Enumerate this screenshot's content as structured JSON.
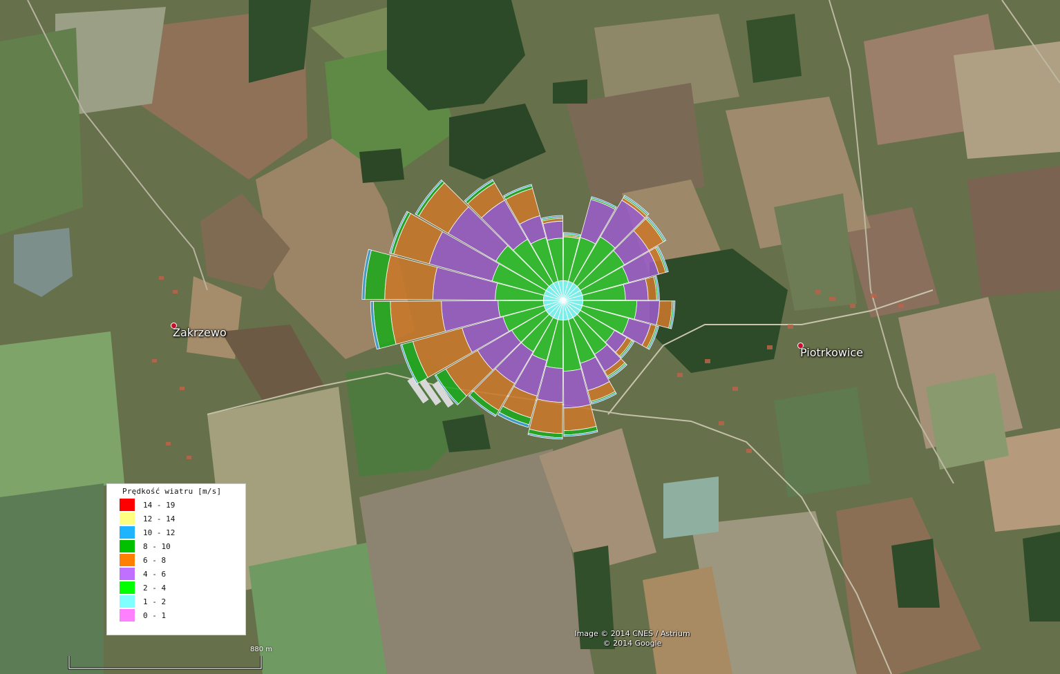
{
  "places": [
    {
      "name": "Zakrzewo"
    },
    {
      "name": "Piotrkowice"
    }
  ],
  "legend": {
    "title": "Prędkość wiatru [m/s]",
    "items": [
      {
        "label": "14 - 19",
        "color": "#ff0000"
      },
      {
        "label": "12 - 14",
        "color": "#ffff80"
      },
      {
        "label": "10 - 12",
        "color": "#1eb4ff"
      },
      {
        "label": "8 - 10",
        "color": "#00c000"
      },
      {
        "label": "6 - 8",
        "color": "#ff8000"
      },
      {
        "label": "4 - 6",
        "color": "#c070ff"
      },
      {
        "label": "2 - 4",
        "color": "#00ff00"
      },
      {
        "label": "1 - 2",
        "color": "#80ffff"
      },
      {
        "label": "0 - 1",
        "color": "#ff80ff"
      }
    ]
  },
  "attribution": {
    "line1": "Image © 2014 CNES / Astrium",
    "line2": "© 2014 Google"
  },
  "scale": {
    "label": "880 m"
  },
  "wind_rose": {
    "bins": [
      "0 - 1",
      "1 - 2",
      "2 - 4",
      "4 - 6",
      "6 - 8",
      "8 - 10",
      "10 - 12",
      "12 - 14",
      "14 - 19"
    ],
    "colors": {
      "1 - 2": "#80ffff",
      "2 - 4": "#2fc02f",
      "4 - 6": "#9a5cc8",
      "6 - 8": "#c9782a",
      "8 - 10": "#1fa81f",
      "10 - 12": "#3a9ed0",
      "12 - 14": "#f3e68a"
    },
    "sectors": [
      {
        "cum": [
          0.14,
          0.45,
          0.45,
          0.46,
          0.47,
          0.48
        ]
      },
      {
        "cum": [
          0.14,
          0.46,
          0.74,
          0.74,
          0.75,
          0.76
        ]
      },
      {
        "cum": [
          0.14,
          0.52,
          0.82,
          0.84,
          0.85,
          0.86
        ]
      },
      {
        "cum": [
          0.14,
          0.5,
          0.7,
          0.82,
          0.83,
          0.84
        ]
      },
      {
        "cum": [
          0.14,
          0.48,
          0.7,
          0.75,
          0.76,
          0.77
        ]
      },
      {
        "cum": [
          0.14,
          0.44,
          0.6,
          0.66,
          0.67,
          0.68
        ]
      },
      {
        "cum": [
          0.14,
          0.52,
          0.68,
          0.77,
          0.78,
          0.79
        ]
      },
      {
        "cum": [
          0.14,
          0.48,
          0.64,
          0.68,
          0.69,
          0.7
        ]
      },
      {
        "cum": [
          0.14,
          0.42,
          0.52,
          0.56,
          0.57,
          0.58
        ]
      },
      {
        "cum": [
          0.14,
          0.44,
          0.58,
          0.62,
          0.63,
          0.64
        ]
      },
      {
        "cum": [
          0.14,
          0.46,
          0.66,
          0.74,
          0.75,
          0.76
        ]
      },
      {
        "cum": [
          0.14,
          0.5,
          0.76,
          0.92,
          0.95,
          0.96
        ]
      },
      {
        "cum": [
          0.14,
          0.48,
          0.72,
          0.94,
          0.97,
          0.98
        ]
      },
      {
        "cum": [
          0.14,
          0.44,
          0.7,
          0.86,
          0.91,
          0.93
        ]
      },
      {
        "cum": [
          0.14,
          0.42,
          0.68,
          0.9,
          0.94,
          0.95
        ]
      },
      {
        "cum": [
          0.14,
          0.42,
          0.7,
          0.96,
          1.04,
          1.05
        ]
      },
      {
        "cum": [
          0.14,
          0.44,
          0.74,
          1.1,
          1.18,
          1.19
        ]
      },
      {
        "cum": [
          0.14,
          0.46,
          0.86,
          1.22,
          1.34,
          1.36
        ]
      },
      {
        "cum": [
          0.14,
          0.48,
          0.92,
          1.26,
          1.4,
          1.42
        ]
      },
      {
        "cum": [
          0.14,
          0.52,
          0.98,
          1.24,
          1.26,
          1.27
        ]
      },
      {
        "cum": [
          0.14,
          0.55,
          0.94,
          1.18,
          1.2,
          1.21
        ]
      },
      {
        "cum": [
          0.14,
          0.5,
          0.82,
          0.96,
          0.98,
          0.99
        ]
      },
      {
        "cum": [
          0.14,
          0.46,
          0.62,
          0.82,
          0.84,
          0.85
        ]
      },
      {
        "cum": [
          0.14,
          0.44,
          0.56,
          0.58,
          0.59,
          0.6
        ]
      }
    ]
  }
}
